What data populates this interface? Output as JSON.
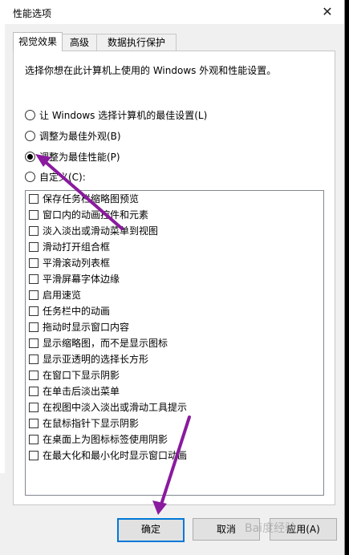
{
  "window": {
    "title": "性能选项"
  },
  "tabs": [
    {
      "label": "视觉效果"
    },
    {
      "label": "高级"
    },
    {
      "label": "数据执行保护"
    }
  ],
  "description": "选择你想在此计算机上使用的 Windows 外观和性能设置。",
  "radio_options": [
    {
      "label": "让 Windows 选择计算机的最佳设置(L)",
      "checked": false
    },
    {
      "label": "调整为最佳外观(B)",
      "checked": false
    },
    {
      "label": "调整为最佳性能(P)",
      "checked": true
    },
    {
      "label": "自定义(C):",
      "checked": false
    }
  ],
  "effects": [
    "保存任务栏缩略图预览",
    "窗口内的动画控件和元素",
    "淡入淡出或滑动菜单到视图",
    "滑动打开组合框",
    "平滑滚动列表框",
    "平滑屏幕字体边缘",
    "启用速览",
    "任务栏中的动画",
    "拖动时显示窗口内容",
    "显示缩略图，而不是显示图标",
    "显示亚透明的选择长方形",
    "在窗口下显示阴影",
    "在单击后淡出菜单",
    "在视图中淡入淡出或滑动工具提示",
    "在鼠标指针下显示阴影",
    "在桌面上为图标标签使用阴影",
    "在最大化和最小化时显示窗口动画"
  ],
  "buttons": {
    "ok": "确定",
    "cancel": "取消",
    "apply": "应用(A)"
  },
  "watermark": "Bai度经验",
  "colors": {
    "annotation_arrow": "#8a1a9e",
    "default_button_border": "#0078d7"
  }
}
